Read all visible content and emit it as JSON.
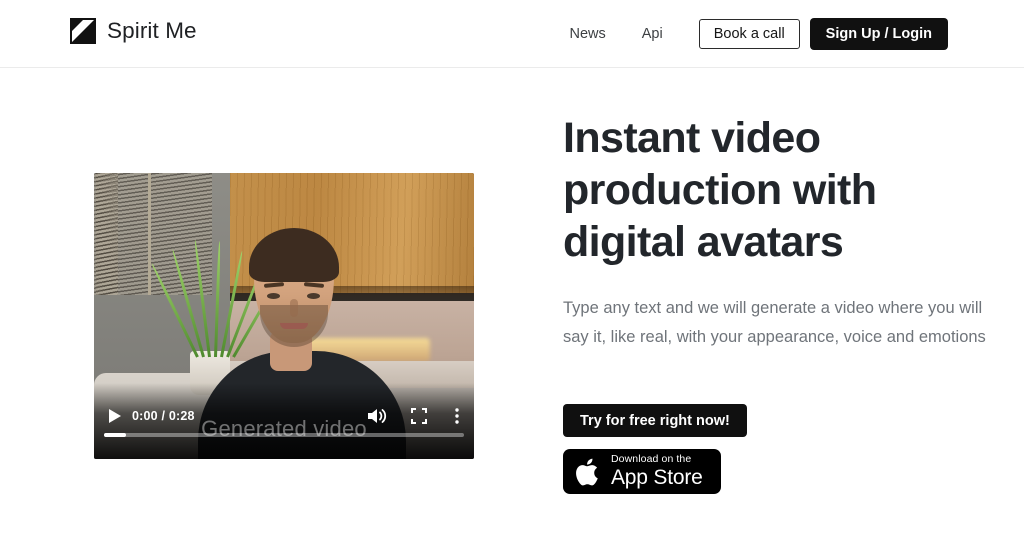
{
  "header": {
    "logo_icon": "spirit-me-square-diagonal-logo",
    "brand": "Spirit Me",
    "nav": [
      {
        "label": "News",
        "name": "nav-link-news"
      },
      {
        "label": "Api",
        "name": "nav-link-api"
      }
    ],
    "book_call_label": "Book a call",
    "signup_label": "Sign Up / Login"
  },
  "hero": {
    "headline": "Instant video production with digital avatars",
    "subhead": "Type any text and we will generate a video where you will say it, like real, with your appearance, voice and emotions",
    "cta_primary": "Try for free right now!",
    "appstore": {
      "small": "Download on the",
      "big": "App Store",
      "icon": "apple-logo-icon"
    }
  },
  "video": {
    "overlay_title": "Generated video",
    "current_time": "0:00",
    "duration": "0:28",
    "time_display": "0:00 / 0:28",
    "progress_percent": 6,
    "controls": {
      "play": "play-icon",
      "volume": "volume-icon",
      "fullscreen": "fullscreen-icon",
      "more": "more-options-icon"
    }
  },
  "colors": {
    "accent_dark": "#111111",
    "text_primary": "#22262b",
    "text_muted": "#6f747a",
    "border": "#ebebeb",
    "page_bg": "#ffffff"
  }
}
